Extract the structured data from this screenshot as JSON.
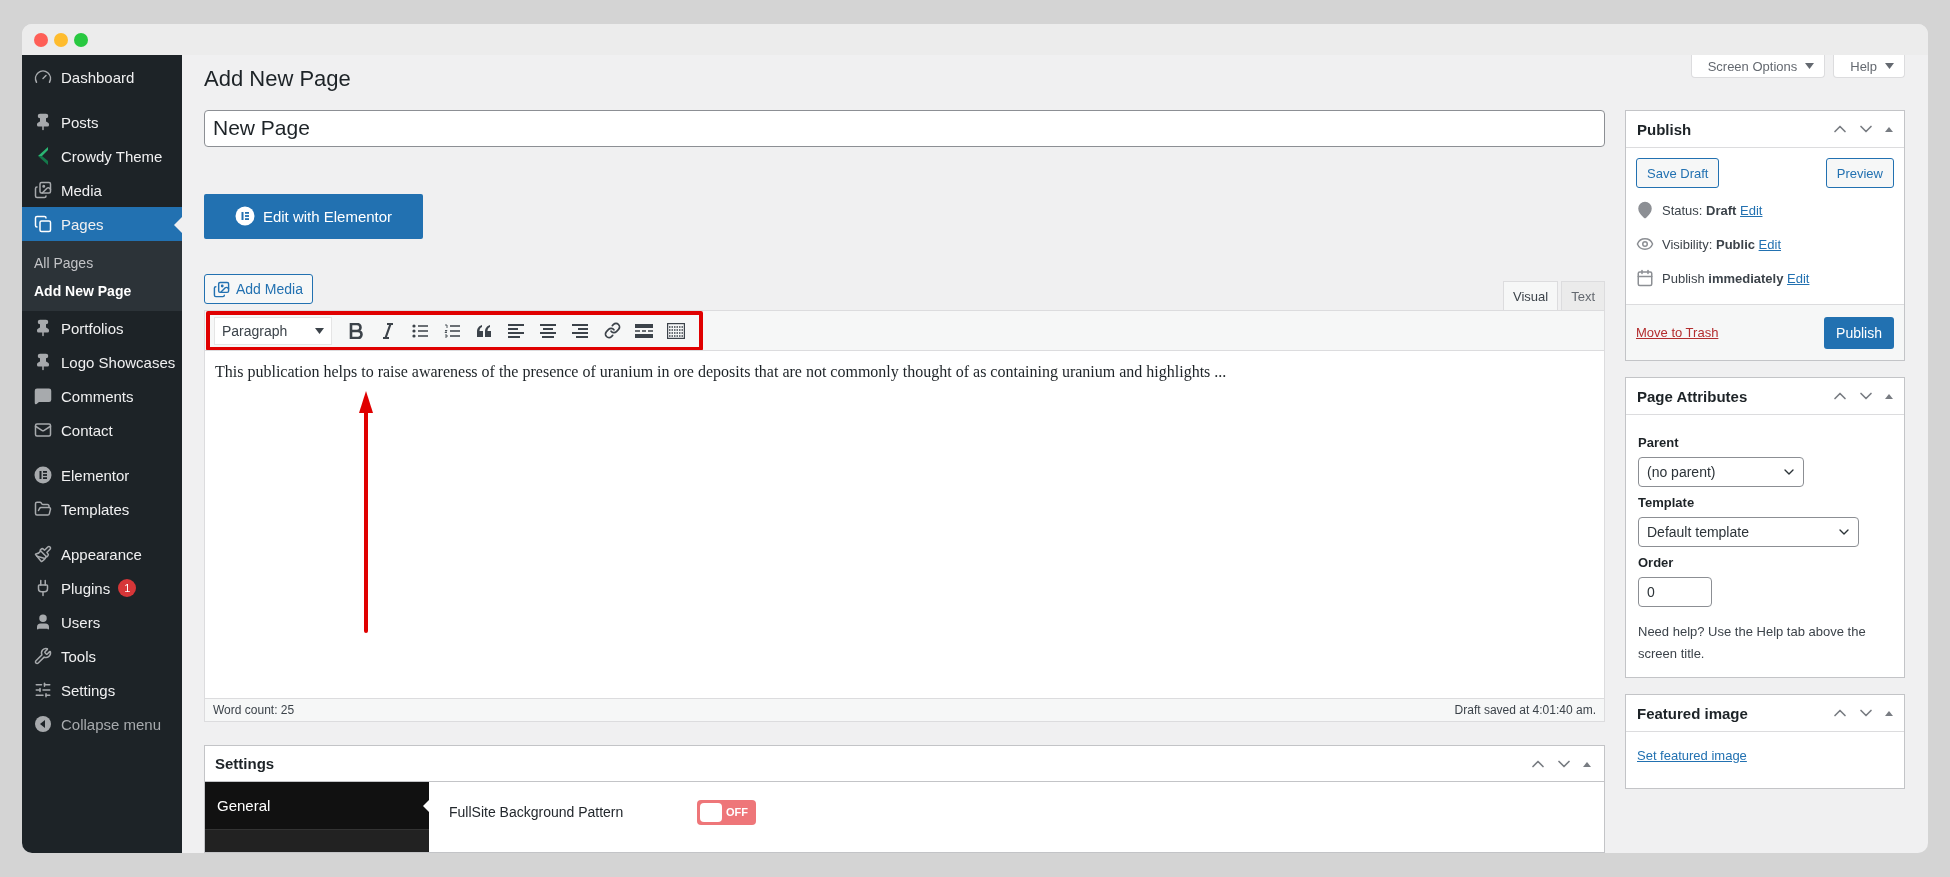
{
  "sidebar": {
    "groups": [
      {
        "items": [
          {
            "kind": "menu",
            "label": "Dashboard",
            "selected": false
          }
        ]
      },
      {
        "items": [
          {
            "kind": "menu",
            "label": "Posts",
            "selected": false
          },
          {
            "kind": "menu",
            "label": "Crowdy Theme",
            "selected": false
          },
          {
            "kind": "menu",
            "label": "Media",
            "selected": false
          },
          {
            "kind": "menu",
            "label": "Pages",
            "selected": true,
            "children": [
              {
                "label": "All Pages",
                "selected": false
              },
              {
                "label": "Add New Page",
                "selected": true
              }
            ]
          },
          {
            "kind": "menu",
            "label": "Portfolios",
            "selected": false
          },
          {
            "kind": "menu",
            "label": "Logo Showcases",
            "selected": false
          },
          {
            "kind": "menu",
            "label": "Comments",
            "selected": false
          },
          {
            "kind": "menu",
            "label": "Contact",
            "selected": false
          }
        ]
      },
      {
        "items": [
          {
            "kind": "menu",
            "label": "Elementor",
            "selected": false
          },
          {
            "kind": "menu",
            "label": "Templates",
            "selected": false
          }
        ]
      },
      {
        "items": [
          {
            "kind": "menu",
            "label": "Appearance",
            "selected": false
          },
          {
            "kind": "menu",
            "label": "Plugins",
            "selected": false,
            "badge": "1"
          },
          {
            "kind": "menu",
            "label": "Users",
            "selected": false
          },
          {
            "kind": "menu",
            "label": "Tools",
            "selected": false
          },
          {
            "kind": "menu",
            "label": "Settings",
            "selected": false
          },
          {
            "kind": "collapse",
            "label": "Collapse menu",
            "selected": false
          }
        ]
      }
    ]
  },
  "screen_meta": [
    "Screen Options",
    "Help"
  ],
  "title": "Add New Page",
  "title_field": {
    "value": "New Page"
  },
  "elementor_button": "Edit with Elementor",
  "add_media": "Add Media",
  "editor_tabs": [
    {
      "label": "Visual",
      "selected": true
    },
    {
      "label": "Text",
      "selected": false
    }
  ],
  "toolbar": {
    "format": "Paragraph",
    "tools": [
      {
        "kind": "bold"
      },
      {
        "kind": "italic"
      },
      {
        "kind": "bullets"
      },
      {
        "kind": "numbers"
      },
      {
        "kind": "quote"
      },
      {
        "kind": "align-left"
      },
      {
        "kind": "align-center"
      },
      {
        "kind": "align-right"
      },
      {
        "kind": "link"
      },
      {
        "kind": "more"
      },
      {
        "kind": "kitchen"
      }
    ]
  },
  "content": "This publication helps to raise awareness of the presence of uranium in ore deposits that are not commonly thought of as containing uranium and highlights ...",
  "word_count": "Word count: 25",
  "draft_saved": "Draft saved at 4:01:40 am.",
  "settings": {
    "title": "Settings",
    "tabs": [
      {
        "label": "General",
        "selected": true
      }
    ],
    "field": {
      "label": "FullSite Background Pattern",
      "toggle": {
        "on": false,
        "label": "OFF"
      }
    }
  },
  "publish": {
    "title": "Publish",
    "save_draft": "Save Draft",
    "preview": "Preview",
    "rows": [
      {
        "kind": "status",
        "label": "Status:",
        "value": "Draft",
        "link": "Edit"
      },
      {
        "kind": "visibility",
        "label": "Visibility:",
        "value": "Public",
        "link": "Edit"
      },
      {
        "kind": "schedule",
        "label": "Publish",
        "value": "immediately",
        "link": "Edit"
      }
    ],
    "trash": "Move to Trash",
    "button": "Publish"
  },
  "page_attributes": {
    "title": "Page Attributes",
    "parent_label": "Parent",
    "parent": "(no parent)",
    "template_label": "Template",
    "template": "Default template",
    "order_label": "Order",
    "order": "0",
    "help": "Need help? Use the Help tab above the screen title."
  },
  "featured_image": {
    "title": "Featured image",
    "link": "Set featured image"
  }
}
